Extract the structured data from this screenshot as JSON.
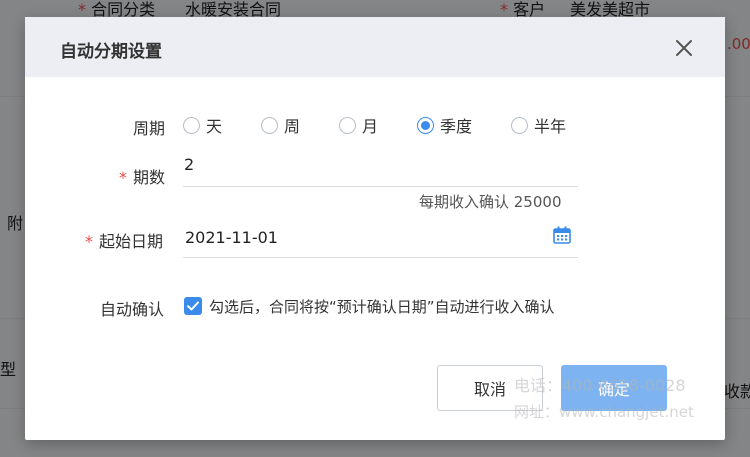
{
  "background": {
    "contract_type_label": "合同分类",
    "contract_type_value": "水暖安装合同",
    "customer_label": "客户",
    "customer_value": "美发美超市",
    "right_amount": ".00",
    "left_label_1": "附",
    "left_label_2": "型",
    "right_label": "收款"
  },
  "dialog": {
    "title": "自动分期设置",
    "period_label": "周期",
    "period_options": [
      "天",
      "周",
      "月",
      "季度",
      "半年"
    ],
    "period_selected": "季度",
    "count_label": "期数",
    "count_value": "2",
    "per_period_hint": "每期收入确认 25000",
    "start_date_label": "起始日期",
    "start_date_value": "2021-11-01",
    "auto_confirm_label": "自动确认",
    "auto_confirm_checked": true,
    "auto_confirm_text": "勾选后，合同将按“预计确认日期”自动进行收入确认",
    "cancel_label": "取消",
    "ok_label": "确定"
  },
  "watermark": {
    "phone": "电话：400-6658-0028",
    "site": "网址：www.changjet.net"
  },
  "colors": {
    "primary": "#3b8bea",
    "primary_disabled": "#7db3f0",
    "required": "#e84c4c",
    "header_bg": "#eceef4"
  }
}
